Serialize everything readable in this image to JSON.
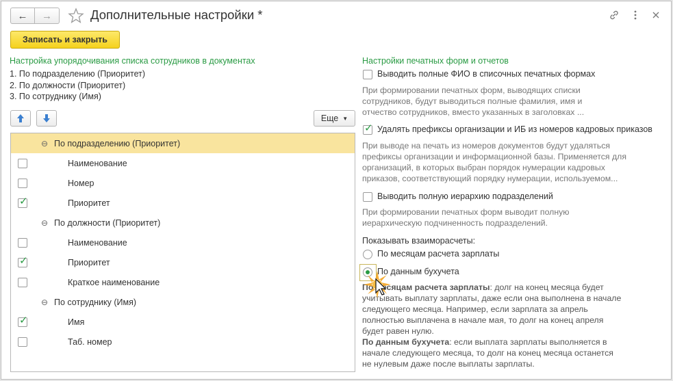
{
  "window": {
    "title": "Дополнительные настройки *",
    "write_close": "Записать и закрыть"
  },
  "left": {
    "section_title": "Настройка упорядочивания списка сотрудников в документах",
    "order": [
      "1. По подразделению (Приоритет)",
      "2. По должности (Приоритет)",
      "3. По сотруднику (Имя)"
    ],
    "more_button": "Еще",
    "tree": [
      {
        "type": "group",
        "label": "По подразделению (Приоритет)",
        "selected": true
      },
      {
        "type": "leaf",
        "label": "Наименование",
        "checked": false
      },
      {
        "type": "leaf",
        "label": "Номер",
        "checked": false
      },
      {
        "type": "leaf",
        "label": "Приоритет",
        "checked": true
      },
      {
        "type": "group",
        "label": "По должности (Приоритет)",
        "selected": false
      },
      {
        "type": "leaf",
        "label": "Наименование",
        "checked": false
      },
      {
        "type": "leaf",
        "label": "Приоритет",
        "checked": true
      },
      {
        "type": "leaf",
        "label": "Краткое наименование",
        "checked": false
      },
      {
        "type": "group",
        "label": "По сотруднику (Имя)",
        "selected": false
      },
      {
        "type": "leaf",
        "label": "Имя",
        "checked": true
      },
      {
        "type": "leaf",
        "label": "Таб. номер",
        "checked": false
      }
    ]
  },
  "right": {
    "section_title": "Настройки печатных форм и отчетов",
    "opt1": {
      "label": "Выводить полные ФИО в списочных печатных формах",
      "checked": false,
      "desc": [
        "При формировании печатных форм, выводящих списки",
        "сотрудников, будут выводиться полные фамилия, имя и",
        "отчество сотрудников, вместо указанных в заголовках ..."
      ]
    },
    "opt2": {
      "label": "Удалять префиксы организации и ИБ из номеров кадровых приказов",
      "checked": true,
      "desc": [
        "При выводе на печать из номеров документов будут удаляться",
        "префиксы организации и информационной базы. Применяется для",
        "организаций, в которых выбран порядок нумерации кадровых",
        "приказов, соответствующий порядку нумерации, используемом..."
      ]
    },
    "opt3": {
      "label": "Выводить полную иерархию подразделений",
      "checked": false,
      "desc": [
        "При формировании печатных форм выводит полную",
        "иерархическую подчиненность подразделений."
      ]
    },
    "settlements_label": "Показывать взаиморасчеты:",
    "radio1": "По месяцам расчета зарплаты",
    "radio2": "По данным бухучета",
    "selected_radio": "radio2",
    "tooltip": {
      "l1_bold": "По месяцам расчета зарплаты",
      "l1_rest": ": долг на конец месяца будет",
      "l2": "учитывать выплату зарплаты, даже если она выполнена в начале",
      "l3": "следующего месяца. Например, если зарплата за апрель",
      "l4": "полностью выплачена в начале мая, то долг на конец апреля",
      "l5": "будет равен нулю.",
      "l6_bold": "По данным бухучета",
      "l6_rest": ": если выплата зарплаты выполняется в",
      "l7": "начале следующего месяца, то долг на конец месяца останется",
      "l8": "не нулевым даже после выплаты зарплаты."
    }
  },
  "colors": {
    "accent_green": "#2a9b44",
    "primary_yellow": "#f5d21d",
    "selected_row": "#f9e49e"
  }
}
